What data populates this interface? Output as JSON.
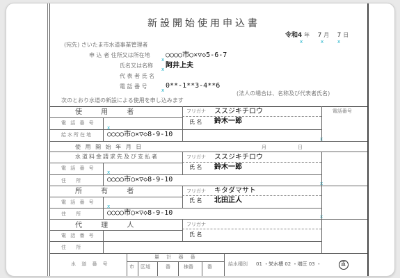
{
  "document": {
    "title": "新設開始使用申込書",
    "top_right": "",
    "date": {
      "era": "令和",
      "year": "4",
      "y_unit": "年",
      "month": "7",
      "m_unit": "月",
      "day": "7",
      "d_unit": "日"
    },
    "addressee": "(宛先) さいたま市水道事業管理者",
    "applicant": {
      "address_label": "申 込 者 住所又は所在地",
      "address_value": "○○○○市○×▽◇5-6-7",
      "name_label": "氏名又は名称",
      "name_value": "阿井上夫",
      "rep_label": "代 表 者 氏 名",
      "rep_value": "",
      "phone_label": "電 話 番 号",
      "phone_value": "0**-1**3-4**6"
    },
    "notice": "次のとおり水道の新設による使用を申し込みます",
    "corp_note": "(法人の場合は、名称及び代表者氏名)",
    "user_section": {
      "header": "使 用 者",
      "furigana_label": "フリガナ",
      "furigana_value": "ススジキチロウ",
      "name_label": "氏 名",
      "name_value": "鈴木一郎",
      "phone_label": "電 話 番 号",
      "phone_num_label": "電話番号",
      "water_address_label": "給水所在地",
      "water_address_value": "○○○○市○×▽◇8-9-10"
    },
    "start_date": {
      "label": "使 用 開 始 年 月 日",
      "month": "月",
      "day": "日"
    },
    "billing": {
      "header": "水道料金請求先及び支払者",
      "furigana_label": "フリガナ",
      "furigana_value": "ススジキチロウ",
      "name_label": "氏 名",
      "name_value": "鈴木一郎",
      "phone_label": "電 話 番 号",
      "address_label": "住 所",
      "address_value": "○○○○市○×▽◇8-9-10"
    },
    "owner": {
      "header": "所 有 者",
      "furigana_label": "フリガナ",
      "furigana_value": "キタダマサト",
      "name_label": "氏 名",
      "name_value": "北田正人",
      "phone_label": "電 話 番 号",
      "address_label": "住 所",
      "address_value": "○○○○市○×▽◇8-9-10"
    },
    "agent": {
      "header": "代 理 人",
      "furigana_label": "フリガナ",
      "name_label": "氏 名",
      "phone_label": "電 話 番 号",
      "address_label": "住 所"
    },
    "bottom": {
      "water_no_label": "水 道 番 号",
      "meter_header": "量 計 器 番",
      "meter_cols": [
        "市",
        "区域",
        "番",
        "棟番",
        "番"
      ],
      "type_label": "給水種別",
      "type_options": "01 ・栄水槽 02 ・増圧 03 ・",
      "type_circled": "直"
    }
  }
}
